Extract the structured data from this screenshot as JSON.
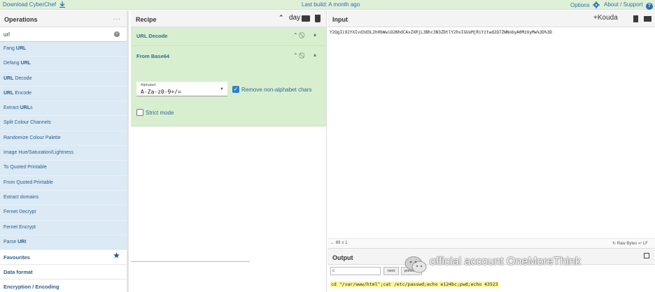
{
  "banner": {
    "download_label": "Download CyberChef",
    "build_label": "Last build: A month ago",
    "options_label": "Options",
    "about_label": "About / Support"
  },
  "operations": {
    "title": "Operations",
    "search_value": "url",
    "items": [
      {
        "pre": "Fang ",
        "match": "URL",
        "post": ""
      },
      {
        "pre": "Defang ",
        "match": "URL",
        "post": ""
      },
      {
        "pre": "",
        "match": "URL",
        "post": " Decode"
      },
      {
        "pre": "",
        "match": "URL",
        "post": " Encode"
      },
      {
        "pre": "Extract ",
        "match": "URL",
        "post": "s"
      },
      {
        "pre": "Split Colour Channels",
        "match": "",
        "post": ""
      },
      {
        "pre": "Randomize Colour Palette",
        "match": "",
        "post": ""
      },
      {
        "pre": "Image Hue/Saturation/Lightness",
        "match": "",
        "post": ""
      },
      {
        "pre": "To Quoted Printable",
        "match": "",
        "post": ""
      },
      {
        "pre": "From Quoted Printable",
        "match": "",
        "post": ""
      },
      {
        "pre": "Extract domains",
        "match": "",
        "post": ""
      },
      {
        "pre": "Fernet Decrypt",
        "match": "",
        "post": ""
      },
      {
        "pre": "Fernet Encrypt",
        "match": "",
        "post": ""
      },
      {
        "pre": "Parse ",
        "match": "URI",
        "post": ""
      }
    ],
    "categories": [
      "Favourites",
      "Data format",
      "Encryption / Encoding"
    ]
  },
  "recipe": {
    "title": "Recipe",
    "day_label": "day",
    "op1_title": "URL Decode",
    "op2_title": "From Base64",
    "alphabet_label": "Alphabet",
    "alphabet_value": "A-Za-z0-9+/=",
    "remove_label": "Remove non-alphabet chars",
    "strict_label": "Strict mode"
  },
  "input": {
    "title": "Input",
    "plus_label": "+Kouda",
    "text": "Y2QgIi92YXIvd3d3L2h0bWwiO2NhdCAvZXRjL3Bhc3N3ZDtlY2hvIGUxMjRiYztwd2Q7ZWNobyA0MzUyMw%3D%3D",
    "status_left": "↔ 89   ≡ 1",
    "status_right": "↻ Raw Bytes  ↩ LF"
  },
  "output": {
    "title": "Output",
    "find_value": "c",
    "next_label": "next",
    "prev_label": "previous",
    "text": "cd \"/var/www/html\";cat /etc/passwd;echo e124bc;pwd;echo 43523"
  },
  "watermark": {
    "text": "official account OneMoreThink"
  },
  "colors": {
    "banner": "#dff0d8",
    "op_list": "#dbeaf5",
    "recipe_card": "#d8efcf",
    "link": "#2a6ebb",
    "highlight": "#fff59a"
  }
}
